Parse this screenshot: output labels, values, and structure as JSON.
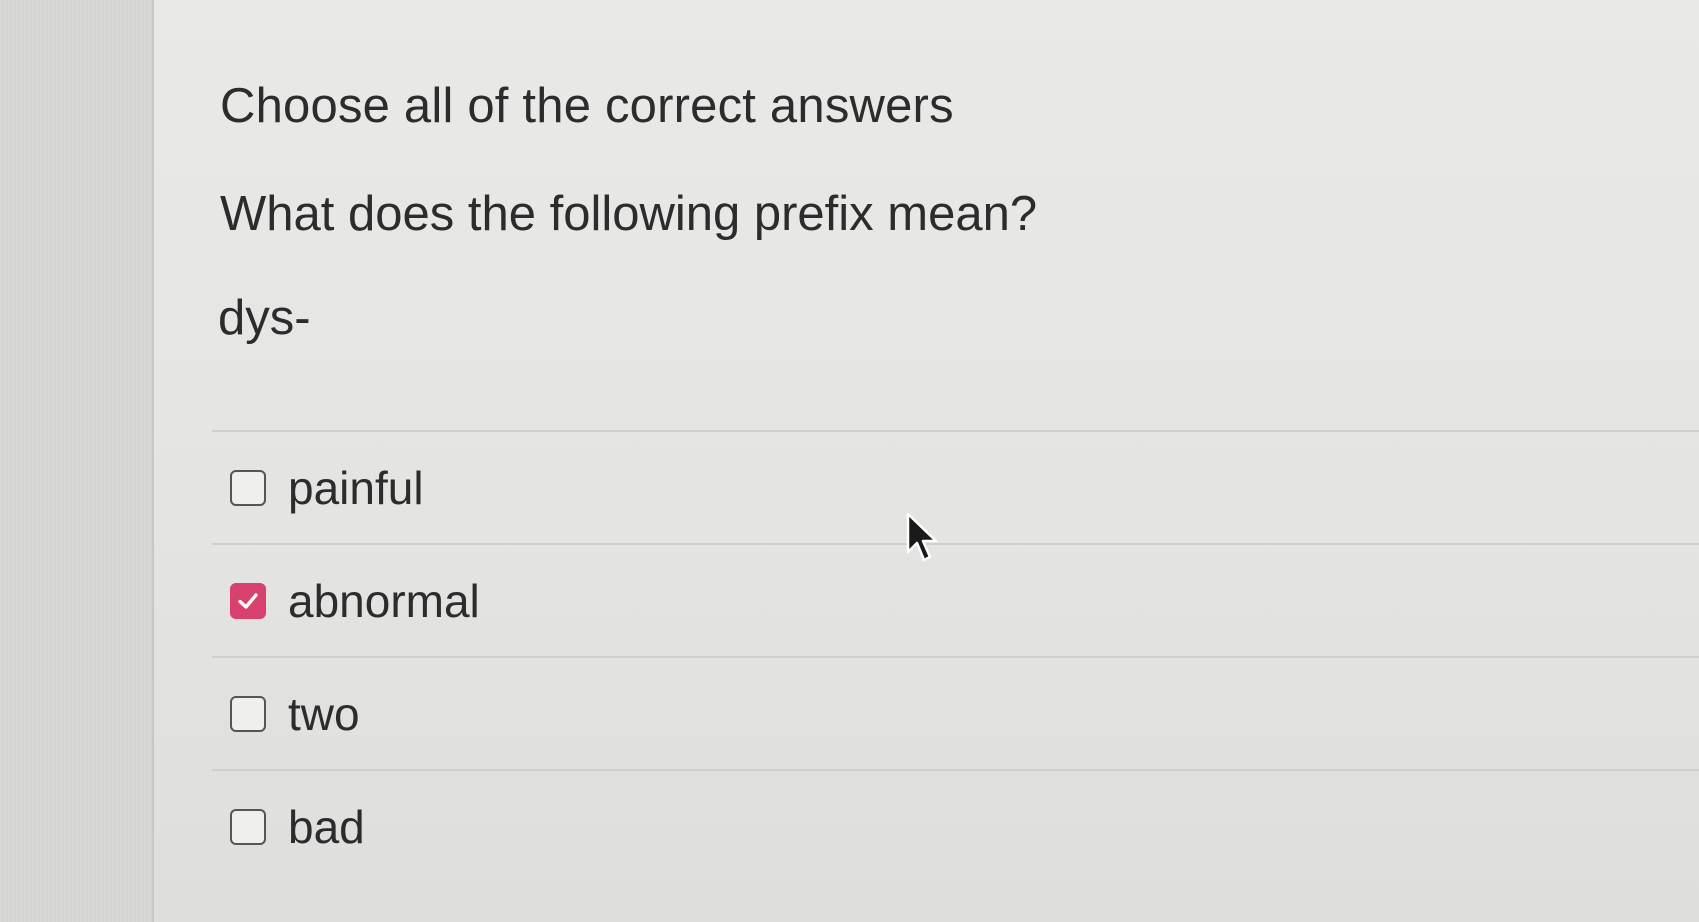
{
  "quiz": {
    "instruction": "Choose all of the correct answers",
    "question": "What does the following prefix mean?",
    "term": "dys-",
    "options": [
      {
        "label": "painful",
        "checked": false
      },
      {
        "label": "abnormal",
        "checked": true
      },
      {
        "label": "two",
        "checked": false
      },
      {
        "label": "bad",
        "checked": false
      }
    ]
  },
  "colors": {
    "checked_accent": "#d8416d",
    "text": "#2c2c2c",
    "background": "#e6e6e4"
  },
  "icons": {
    "checkmark": "checkmark-icon",
    "cursor": "mouse-pointer-icon"
  }
}
